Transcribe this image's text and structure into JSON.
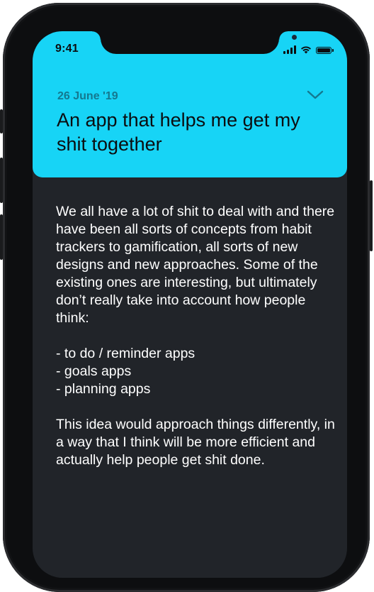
{
  "status_bar": {
    "time": "9:41"
  },
  "note": {
    "date": "26 June '19",
    "title": "An app that helps me get my shit together",
    "intro": "We all have a lot of shit to deal with and there have been all sorts of concepts from habit trackers to gamification, all sorts of new designs and new approaches. Some of the existing ones are interesting, but ultimately don’t really take into account how people think:",
    "list": [
      "- to do / reminder apps",
      "- goals apps",
      "- planning apps"
    ],
    "outro": "This idea would approach things differently, in a way that I think will be more efficient and actually help people get shit done."
  },
  "colors": {
    "header_bg": "#17d4f6",
    "body_bg": "#212429",
    "date_text": "#14788f",
    "body_text": "#ffffff"
  },
  "icons": {
    "collapse": "chevron-down-icon",
    "signal": "cellular-signal-icon",
    "wifi": "wifi-icon",
    "battery": "battery-icon"
  }
}
